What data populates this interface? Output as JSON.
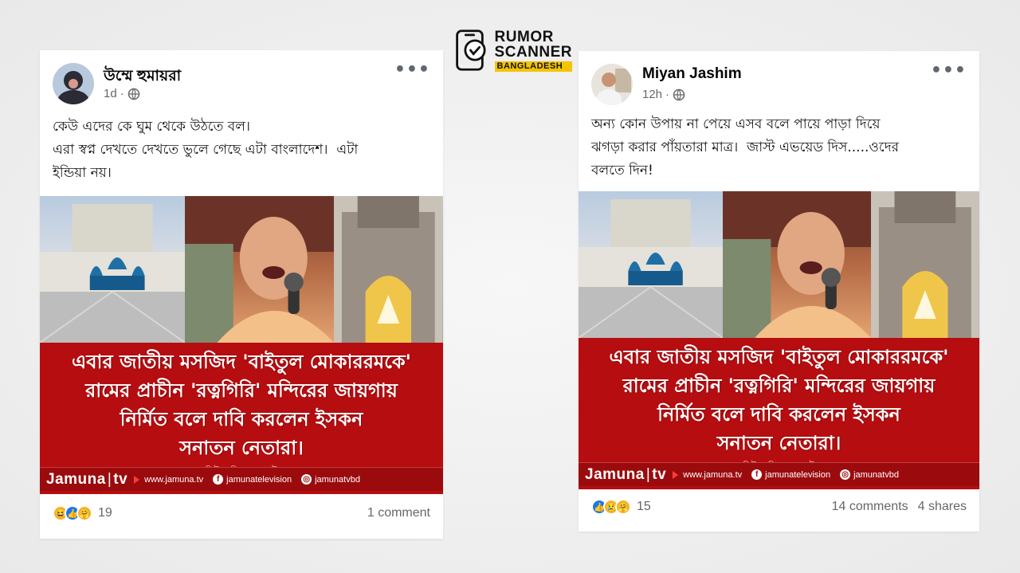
{
  "logo": {
    "line1": "RUMOR",
    "line2": "SCANNER",
    "line3": "BANGLADESH",
    "accent_color": "#f5c400",
    "icon": "phone-check-icon"
  },
  "posts": [
    {
      "author": "উম্মে হুমায়রা",
      "time": "1d",
      "privacy_icon": "globe-icon",
      "text_lines": [
        "কেউ এদের কে ঘুম থেকে উঠতে বল।",
        "এরা স্বপ্ন দেখতে দেখতে ভুলে গেছে এটা বাংলাদেশ।  এটা",
        "ইন্ডিয়া নয়।"
      ],
      "banner": {
        "lines": [
          "এবার জাতীয় মসজিদ 'বাইতুল মোকাররমকে'",
          "রামের প্রাচীন 'রত্নগিরি' মন্দিরের জায়গায়",
          "নির্মিত বলে দাবি করলেন ইসকন",
          "সনাতন নেতারা।"
        ],
        "note": "নিউজ লিংক কমেন্টে",
        "brand": "Jamuna",
        "brand_suffix": "tv",
        "website": "www.jamuna.tv",
        "facebook": "jamunatelevision",
        "instagram": "jamunatvbd",
        "color": "#b50d10"
      },
      "reactions": [
        "haha",
        "like",
        "care"
      ],
      "reaction_count": "19",
      "comments": "1 comment",
      "shares": ""
    },
    {
      "author": "Miyan Jashim",
      "time": "12h",
      "privacy_icon": "globe-icon",
      "text_lines": [
        "অন্য কোন উপায় না পেয়ে এসব বলে পায়ে পাড়া দিয়ে",
        "ঝগড়া করার পাঁয়তারা মাত্র।  জাস্ট এভয়েড দিস.....ওদের",
        "বলতে দিন!"
      ],
      "banner": {
        "lines": [
          "এবার জাতীয় মসজিদ 'বাইতুল মোকাররমকে'",
          "রামের প্রাচীন 'রত্নগিরি' মন্দিরের জায়গায়",
          "নির্মিত বলে দাবি করলেন ইসকন",
          "সনাতন নেতারা।"
        ],
        "note": "নিউজ লিংক কমেন্টে",
        "brand": "Jamuna",
        "brand_suffix": "tv",
        "website": "www.jamuna.tv",
        "facebook": "jamunatelevision",
        "instagram": "jamunatvbd",
        "color": "#b50d10"
      },
      "reactions": [
        "like",
        "sad",
        "care"
      ],
      "reaction_count": "15",
      "comments": "14 comments",
      "shares": "4 shares"
    }
  ]
}
